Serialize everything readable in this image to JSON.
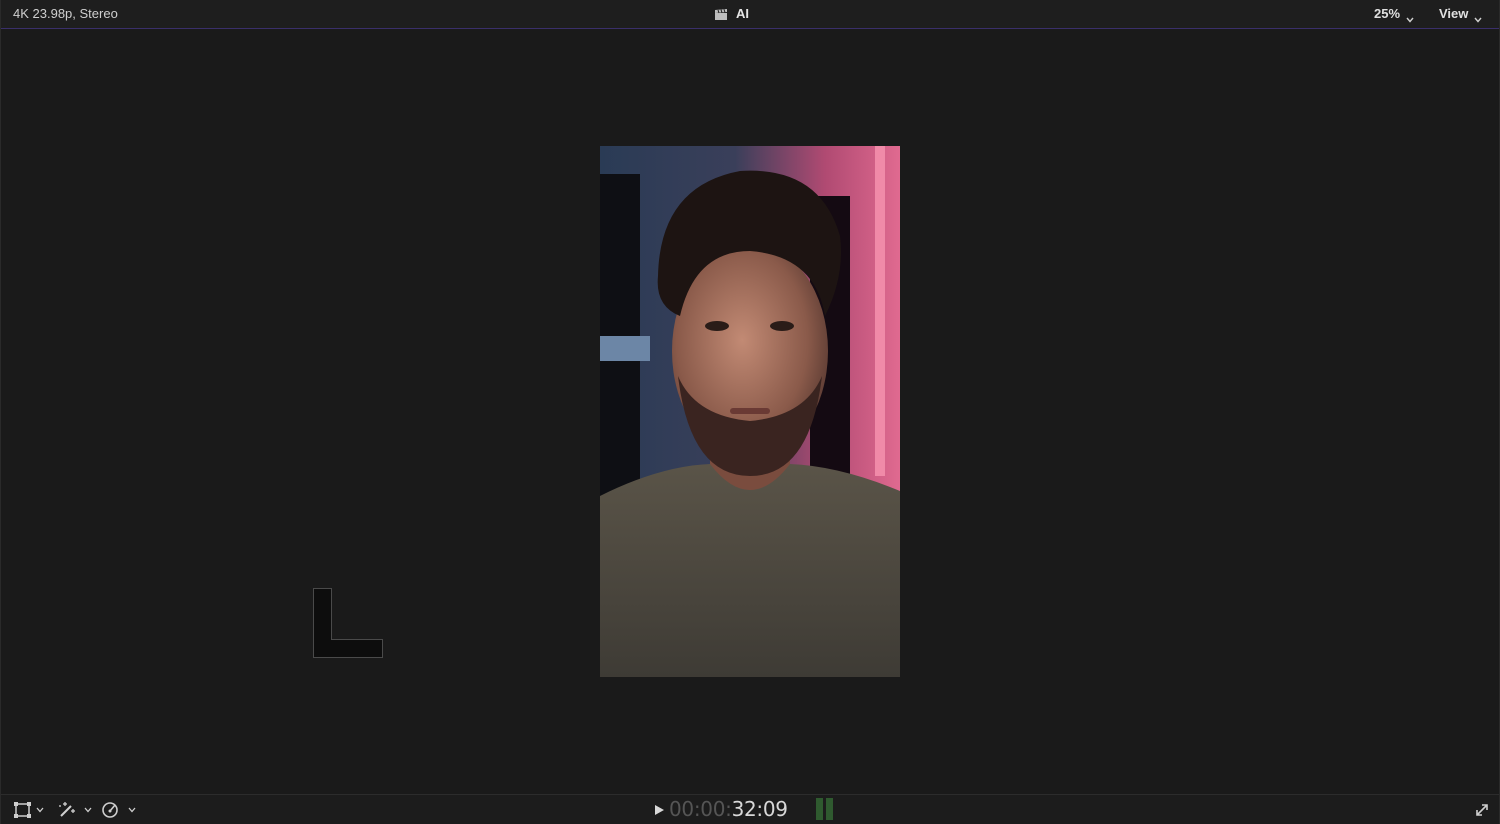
{
  "topbar": {
    "format_label": "4K 23.98p, Stereo",
    "project_title": "AI",
    "zoom_label": "25%",
    "view_label": "View"
  },
  "icons": {
    "clapper": "clapperboard-icon",
    "zoom_chevron": "chevron-down-icon",
    "view_chevron": "chevron-down-icon",
    "transform": "transform-tool-icon",
    "enhance": "magic-wand-icon",
    "retime": "speedometer-icon",
    "play": "play-icon",
    "fullscreen": "fullscreen-icon"
  },
  "bottombar": {
    "timecode_dim": "00:00:",
    "timecode_bright": "32:09"
  },
  "colors": {
    "accent_line": "#3a2f6a",
    "meter_green": "#2f5a2f"
  }
}
